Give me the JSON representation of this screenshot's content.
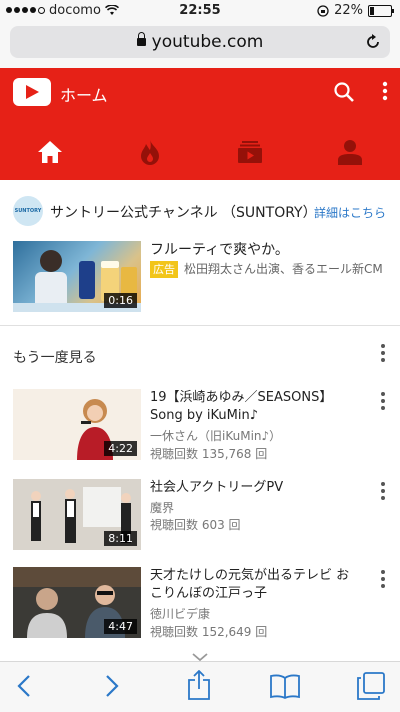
{
  "status_bar": {
    "carrier": "docomo",
    "time": "22:55",
    "battery": "22%",
    "battery_fraction": 0.22
  },
  "browser": {
    "url": "youtube.com"
  },
  "header": {
    "title": "ホーム"
  },
  "tabs": [
    {
      "icon": "home-icon"
    },
    {
      "icon": "trending-icon"
    },
    {
      "icon": "subscriptions-icon"
    },
    {
      "icon": "account-icon"
    }
  ],
  "ad": {
    "avatar_text": "SUNTORY",
    "channel": "サントリー公式チャンネル （SUNTORY）",
    "link": "詳細はこちら",
    "title": "フルーティで爽やか。",
    "badge": "広告",
    "description": "松田翔太さん出演、香るエール新CM",
    "duration": "0:16"
  },
  "section": {
    "title": "もう一度見る"
  },
  "videos": [
    {
      "title": "19【浜崎あゆみ／SEASONS】Song by iKuMin♪",
      "channel": "一休さん（旧iKuMin♪）",
      "views": "視聴回数 135,768 回",
      "duration": "4:22"
    },
    {
      "title": "社会人アクトリーグPV",
      "channel": "魔界",
      "views": "視聴回数 603 回",
      "duration": "8:11"
    },
    {
      "title": "天才たけしの元気が出るテレビ おこりんぼの江戸っ子",
      "channel": "徳川ビデ康",
      "views": "視聴回数 152,649 回",
      "duration": "4:47"
    }
  ],
  "colors": {
    "brand_red": "#e62117",
    "link_blue": "#2b78c8",
    "ad_badge": "#f2c51a"
  }
}
